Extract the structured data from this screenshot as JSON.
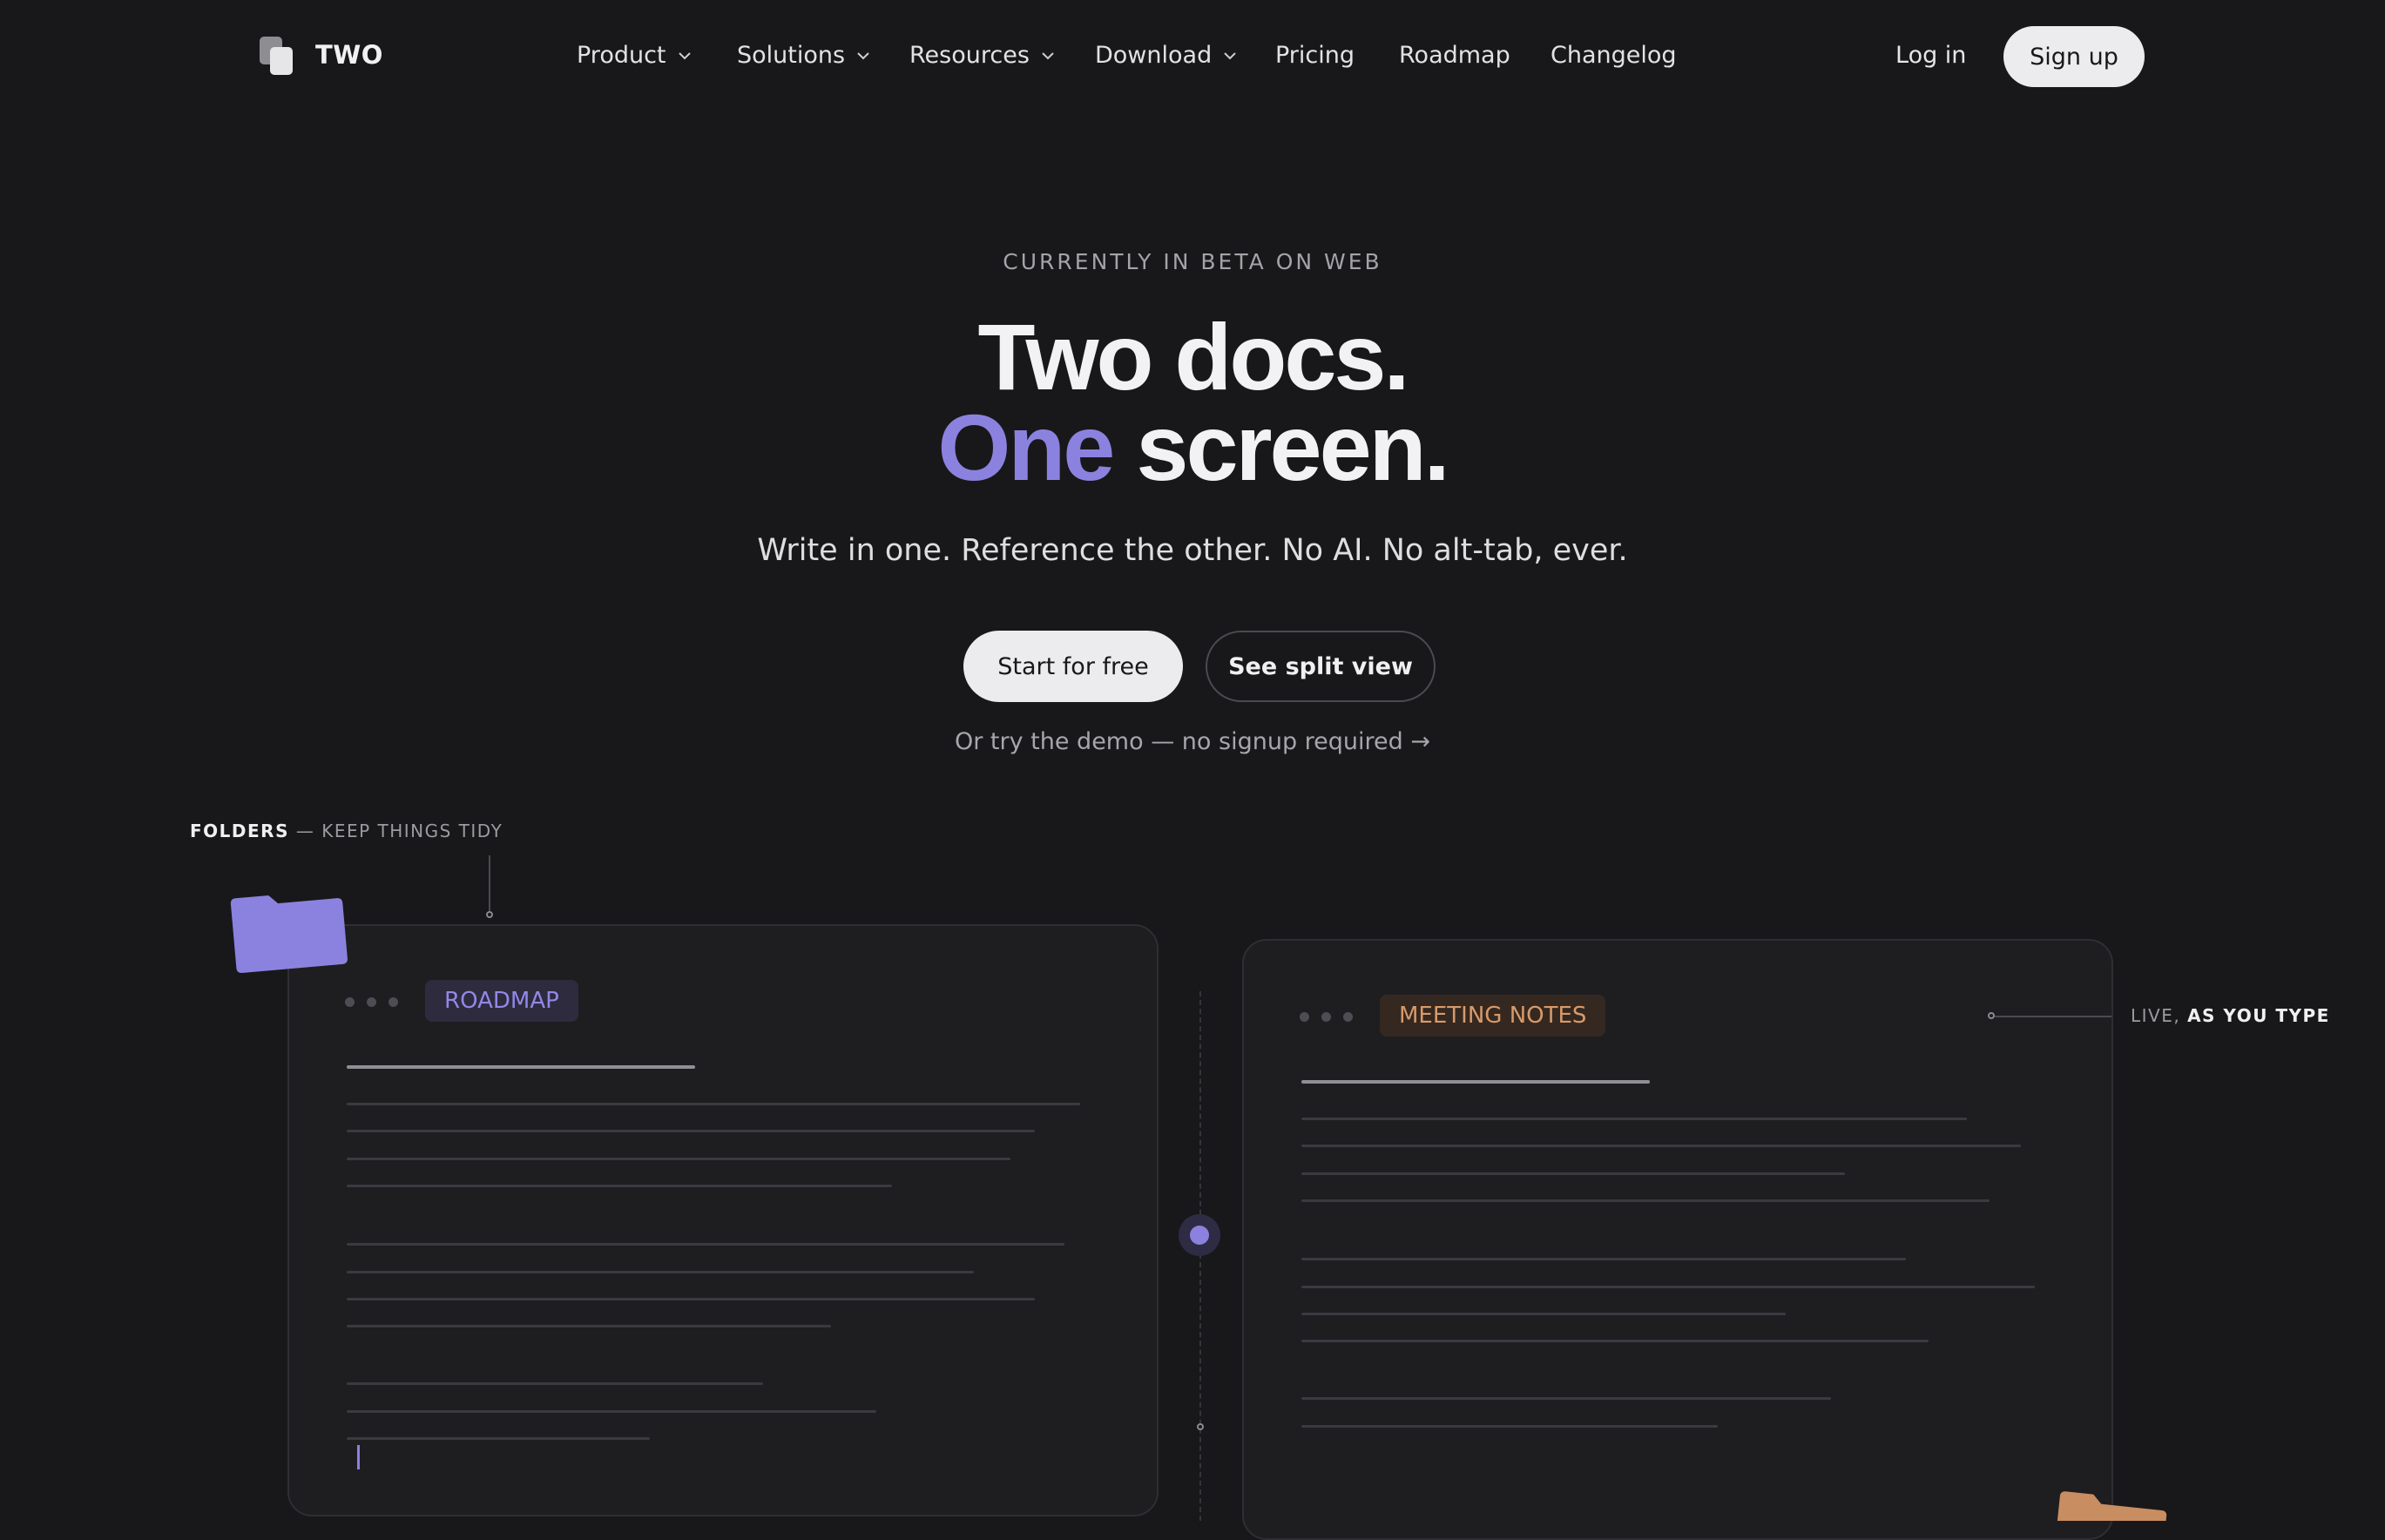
{
  "nav": {
    "brand": "TWO",
    "items": [
      {
        "label": "Product",
        "dropdown": true
      },
      {
        "label": "Solutions",
        "dropdown": true
      },
      {
        "label": "Resources",
        "dropdown": true
      },
      {
        "label": "Download",
        "dropdown": true
      },
      {
        "label": "Pricing",
        "dropdown": false
      },
      {
        "label": "Roadmap",
        "dropdown": false
      },
      {
        "label": "Changelog",
        "dropdown": false
      }
    ],
    "login": "Log in",
    "signup": "Sign up"
  },
  "hero": {
    "eyebrow": "CURRENTLY IN BETA ON WEB",
    "title_line1": "Two docs.",
    "title_accent": "One",
    "title_line2_rest": " screen.",
    "subtitle": "Write in one. Reference the other. No AI. No alt-tab, ever.",
    "primary_cta": "Start for free",
    "secondary_cta": "See split view",
    "demo_link": "Or try the demo — no signup required →"
  },
  "annotations": {
    "folders_strong": "FOLDERS",
    "folders_rest": " — KEEP THINGS TIDY",
    "live_rest": "LIVE, ",
    "live_strong": "AS YOU TYPE"
  },
  "docs": {
    "left_tag": "ROADMAP",
    "right_tag": "MEETING NOTES"
  },
  "colors": {
    "background": "#18181a",
    "accent": "#8b82df",
    "folder_purple": "#8b82df",
    "folder_orange": "#c98d62",
    "tag_orange": "#d89a6a"
  }
}
